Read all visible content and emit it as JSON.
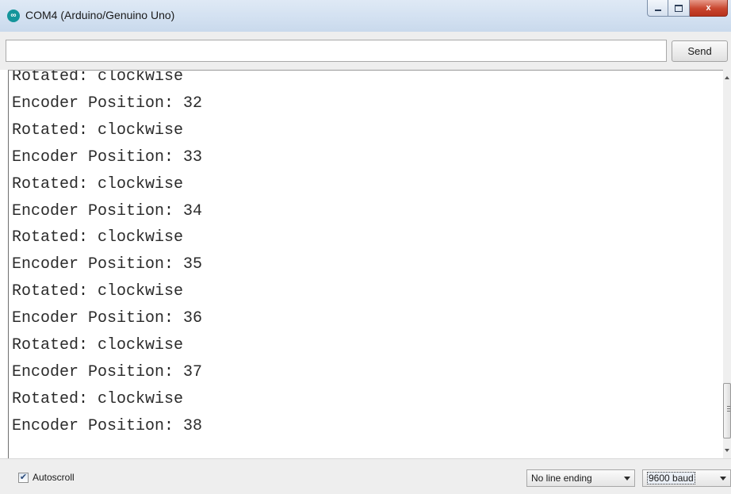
{
  "window": {
    "title": "COM4 (Arduino/Genuino Uno)",
    "icon": "arduino-logo-icon",
    "controls": {
      "minimize": "minimize-icon",
      "maximize": "maximize-icon",
      "close_label": "x"
    }
  },
  "send_row": {
    "input_value": "",
    "send_label": "Send"
  },
  "output": {
    "lines": [
      "Rotated: clockwise",
      "Encoder Position: 32",
      "Rotated: clockwise",
      "Encoder Position: 33",
      "Rotated: clockwise",
      "Encoder Position: 34",
      "Rotated: clockwise",
      "Encoder Position: 35",
      "Rotated: clockwise",
      "Encoder Position: 36",
      "Rotated: clockwise",
      "Encoder Position: 37",
      "Rotated: clockwise",
      "Encoder Position: 38"
    ]
  },
  "bottom_bar": {
    "autoscroll_label": "Autoscroll",
    "autoscroll_checked": true,
    "line_ending": "No line ending",
    "baud_rate": "9600 baud"
  },
  "colors": {
    "titlebar": "#d3e1f1",
    "close_button": "#c8452e",
    "app_icon": "#15959b"
  }
}
